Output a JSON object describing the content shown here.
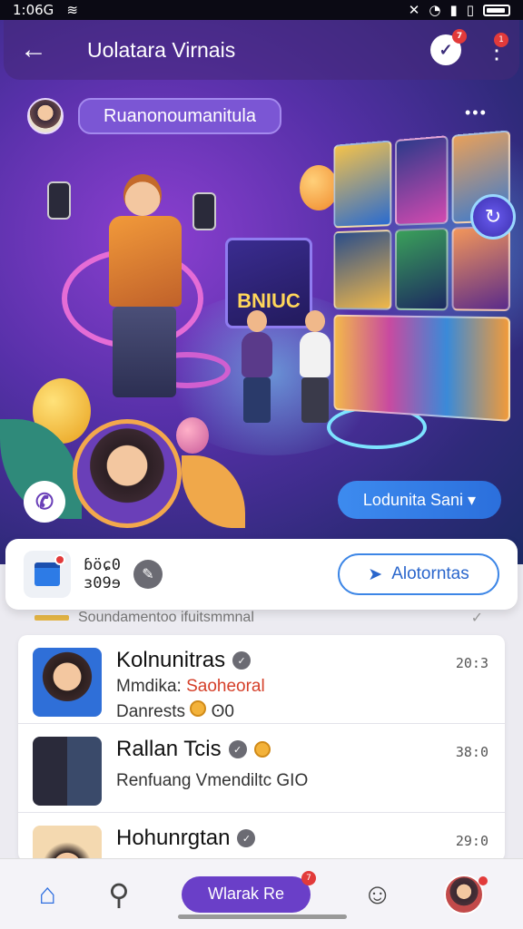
{
  "status_bar": {
    "time": "1:06G"
  },
  "app_bar": {
    "title": "Uolatara Virnais",
    "notification_badge": "7",
    "menu_badge": "1"
  },
  "hero": {
    "profile_pill": "Ruanonoumanitula",
    "more_label": "•••",
    "poster_text": "BNIUC",
    "cta_label": "Lodunita Sani ▾"
  },
  "stats_card": {
    "line1": "ɓöɕ0",
    "line2": "ɜ09ɘ",
    "button_label": "Alotorntas"
  },
  "peek_text": "Soundamentoo ifuitsmmnal",
  "list": [
    {
      "title": "Kolnunitras",
      "line1_prefix": "Mmdika: ",
      "line1_accent": "Saoheoral",
      "line2": "Danrests",
      "line2_extra": "ʘ0",
      "time": "20:3"
    },
    {
      "title": "Rallan Tcis",
      "line1_prefix": "Renfuang Vmendiltc GIO",
      "line1_accent": "",
      "line2": "",
      "line2_extra": "",
      "time": "38:0"
    },
    {
      "title": "Hohunrgtan",
      "line1_prefix": "",
      "line1_accent": "",
      "line2": "",
      "line2_extra": "",
      "time": "29:0"
    }
  ],
  "bottom_nav": {
    "pill_label": "Wlarak Re",
    "pill_badge": "7"
  },
  "colors": {
    "accent_purple": "#6a3fc8",
    "accent_blue": "#2f6fe0",
    "badge_red": "#e23a3a"
  },
  "icons": [
    "back-arrow-icon",
    "chat-icon",
    "kebab-icon",
    "share-icon",
    "calendar-icon",
    "edit-icon",
    "send-icon",
    "home-icon",
    "search-icon",
    "chat-bubble-icon"
  ]
}
